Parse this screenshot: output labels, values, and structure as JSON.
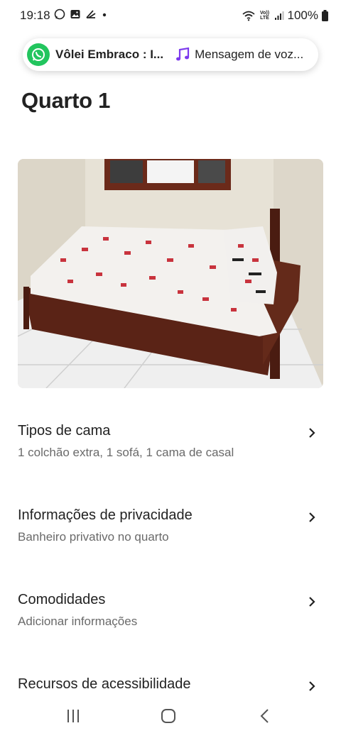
{
  "status_bar": {
    "time": "19:18",
    "battery": "100%",
    "left_icons": [
      "whatsapp-icon",
      "gallery-icon",
      "airbnb-icon",
      "dot-icon"
    ],
    "right_icons": [
      "wifi-icon",
      "volte-icon",
      "signal-icon",
      "battery-icon"
    ],
    "volte_label": "Vo)) LTE"
  },
  "notification": {
    "whatsapp_text": "Vôlei Embraco : I...",
    "music_text": "Mensagem de voz...",
    "whatsapp_color": "#22c55e",
    "music_color": "#7c3aed"
  },
  "page": {
    "title": "Quarto 1"
  },
  "photo": {
    "icon": "room-photo"
  },
  "sections": [
    {
      "title": "Tipos de cama",
      "subtitle": "1 colchão extra, 1 sofá, 1 cama de casal"
    },
    {
      "title": "Informações de privacidade",
      "subtitle": "Banheiro privativo no quarto"
    },
    {
      "title": "Comodidades",
      "subtitle": "Adicionar informações"
    },
    {
      "title": "Recursos de acessibilidade",
      "subtitle": ""
    }
  ],
  "nav": {
    "icons": [
      "recent-apps-icon",
      "home-icon",
      "back-icon"
    ]
  }
}
